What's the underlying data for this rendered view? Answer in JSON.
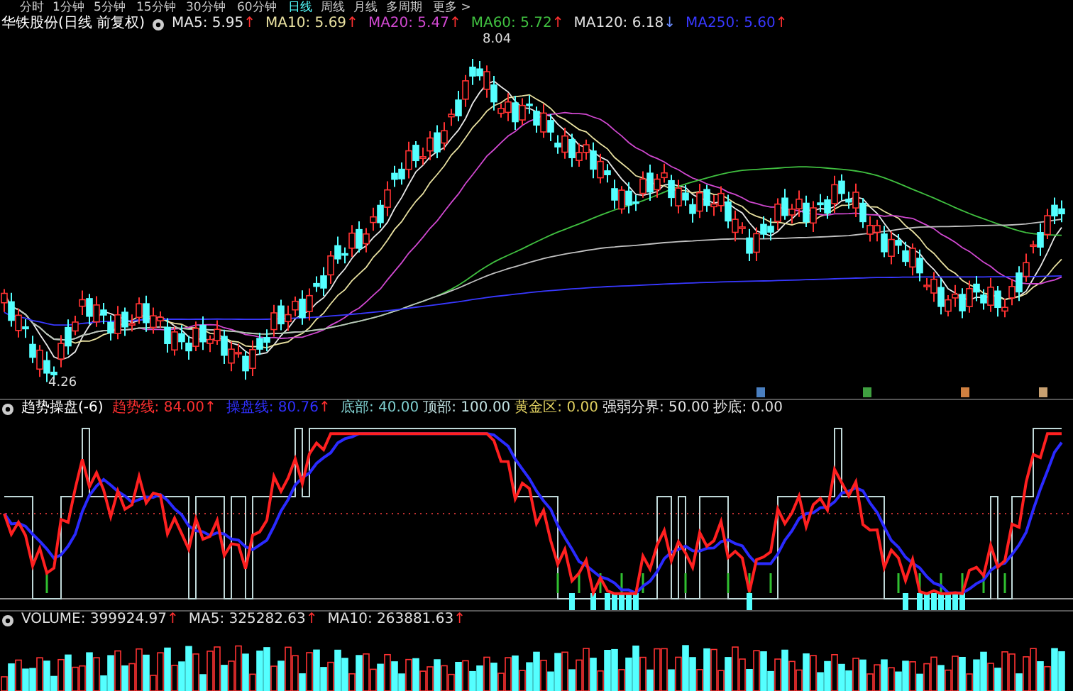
{
  "period_tabs": [
    {
      "label": "分时",
      "selected": false
    },
    {
      "label": "1分钟",
      "selected": false
    },
    {
      "label": "5分钟",
      "selected": false
    },
    {
      "label": "15分钟",
      "selected": false
    },
    {
      "label": "30分钟",
      "selected": false
    },
    {
      "label": "60分钟",
      "selected": false
    },
    {
      "label": "日线",
      "selected": true
    },
    {
      "label": "周线",
      "selected": false
    },
    {
      "label": "月线",
      "selected": false
    },
    {
      "label": "多周期",
      "selected": false
    },
    {
      "label": "更多 >",
      "selected": false
    }
  ],
  "title": "华铁股份(日线 前复权)",
  "main_indicators": [
    {
      "text": "MA5: 5.95",
      "arrow": {
        "text": "↑",
        "color": "#ff3030"
      },
      "color": "#e8e8e8"
    },
    {
      "text": "MA10: 5.69",
      "arrow": {
        "text": "↑",
        "color": "#ff3030"
      },
      "color": "#e8e0a0"
    },
    {
      "text": "MA20: 5.47",
      "arrow": {
        "text": "↑",
        "color": "#ff3030"
      },
      "color": "#d048d0"
    },
    {
      "text": "MA60: 5.72",
      "arrow": {
        "text": "↑",
        "color": "#ff3030"
      },
      "color": "#40c040"
    },
    {
      "text": "MA120: 6.18",
      "arrow": {
        "text": "↓",
        "color": "#6a8cff"
      },
      "color": "#e0e0e0"
    },
    {
      "text": "MA250: 5.60",
      "arrow": {
        "text": "↑",
        "color": "#ff3030"
      },
      "color": "#3838ff"
    }
  ],
  "high_label": "8.04",
  "low_label": "4.26",
  "event_markers": [
    {
      "color": "#4a7fc0"
    },
    {
      "color": "#3fa040"
    },
    {
      "color": "#d08040"
    },
    {
      "color": "#c8a070"
    }
  ],
  "oscillator": {
    "name": "趋势操盘(-6)",
    "values": [
      {
        "text": "趋势线: 84.00",
        "arrow": {
          "text": "↑",
          "color": "#ff3030"
        },
        "color": "#ff3030"
      },
      {
        "text": "操盘线: 80.76",
        "arrow": {
          "text": "↑",
          "color": "#ff3030"
        },
        "color": "#3030ff"
      },
      {
        "text": "底部: 40.00",
        "color": "#80d0d0"
      },
      {
        "text": "顶部: 100.00",
        "color": "#c0e0e0"
      },
      {
        "text": "黄金区: 0.00",
        "color": "#e0d060"
      },
      {
        "text": "强弱分界: 50.00",
        "color": "#e0e0e0"
      },
      {
        "text": "抄底: 0.00",
        "color": "#e0e0e0"
      }
    ]
  },
  "volume": {
    "values": [
      {
        "text": "VOLUME: 399924.97",
        "arrow": {
          "text": "↑",
          "color": "#ff3030"
        },
        "color": "#e0e0e0"
      },
      {
        "text": "MA5: 325282.63",
        "arrow": {
          "text": "↑",
          "color": "#ff3030"
        },
        "color": "#e0e0e0"
      },
      {
        "text": "MA10: 263881.63",
        "arrow": {
          "text": "↑",
          "color": "#ff3030"
        },
        "color": "#e0e0e0"
      }
    ]
  }
}
